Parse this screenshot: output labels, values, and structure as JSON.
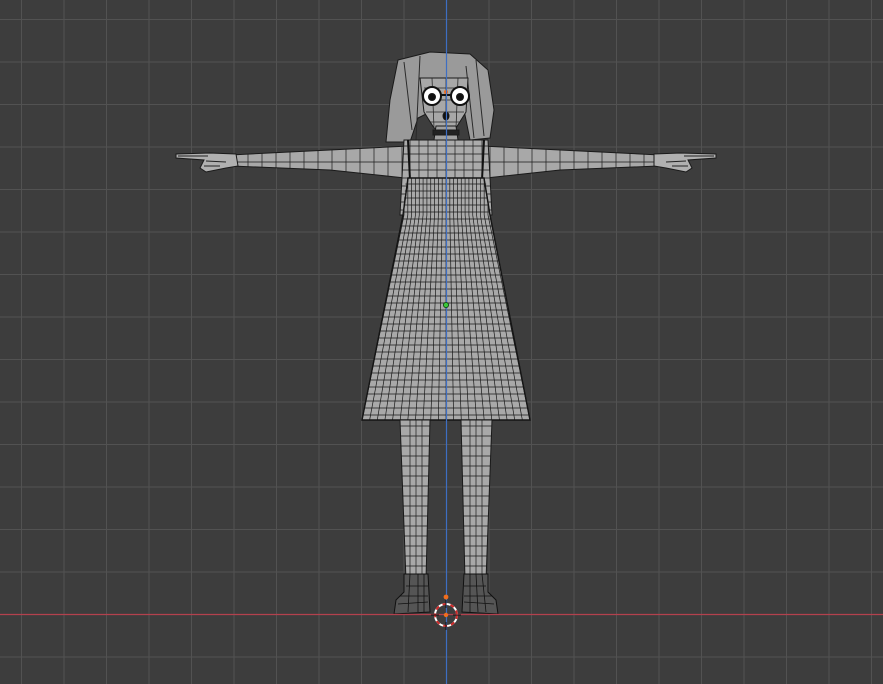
{
  "viewport": {
    "view": "front-orthographic",
    "shading": "solid-with-wireframe-overlay",
    "grid": true,
    "colors": {
      "background": "#3d3d3d",
      "grid_minor": "#484848",
      "grid_major": "#525252",
      "x_axis": "#b3414e",
      "z_axis": "#3e6ec2",
      "mesh_fill": "#a6a6a6",
      "mesh_wire": "#1a1a1a",
      "origin_dot": "#3bc93b",
      "selection_dot": "#f06e1e",
      "cursor_ring_a": "#ffffff",
      "cursor_ring_b": "#cc2a2a"
    }
  },
  "scene_objects": [
    {
      "name": "character-mesh",
      "kind": "mesh",
      "pose": "T-pose",
      "parts": [
        "hair",
        "glasses",
        "head",
        "neck",
        "torso",
        "dress",
        "arms",
        "hands",
        "legs",
        "boots"
      ]
    },
    {
      "name": "3d-cursor",
      "kind": "cursor"
    },
    {
      "name": "object-origin",
      "kind": "origin"
    }
  ]
}
